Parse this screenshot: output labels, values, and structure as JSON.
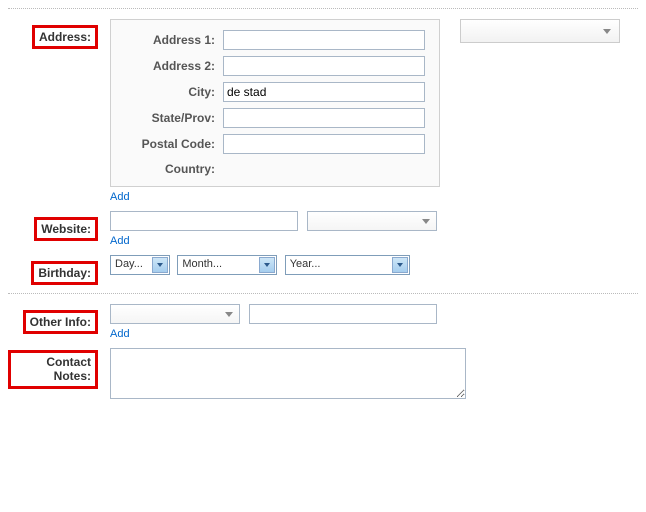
{
  "sections": {
    "address": {
      "label": "Address:",
      "rows": {
        "address1": {
          "label": "Address 1:",
          "value": ""
        },
        "address2": {
          "label": "Address 2:",
          "value": ""
        },
        "city": {
          "label": "City:",
          "value": "de stad"
        },
        "state": {
          "label": "State/Prov:",
          "value": ""
        },
        "postal": {
          "label": "Postal Code:",
          "value": ""
        },
        "country": {
          "label": "Country:",
          "value": ""
        }
      },
      "type_selected": "",
      "add": "Add"
    },
    "website": {
      "label": "Website:",
      "url": "",
      "type_selected": "",
      "add": "Add"
    },
    "birthday": {
      "label": "Birthday:",
      "day": "Day...",
      "month": "Month...",
      "year": "Year..."
    },
    "other": {
      "label": "Other Info:",
      "type_selected": "",
      "value": "",
      "add": "Add"
    },
    "notes": {
      "label": "Contact Notes:",
      "value": ""
    }
  }
}
